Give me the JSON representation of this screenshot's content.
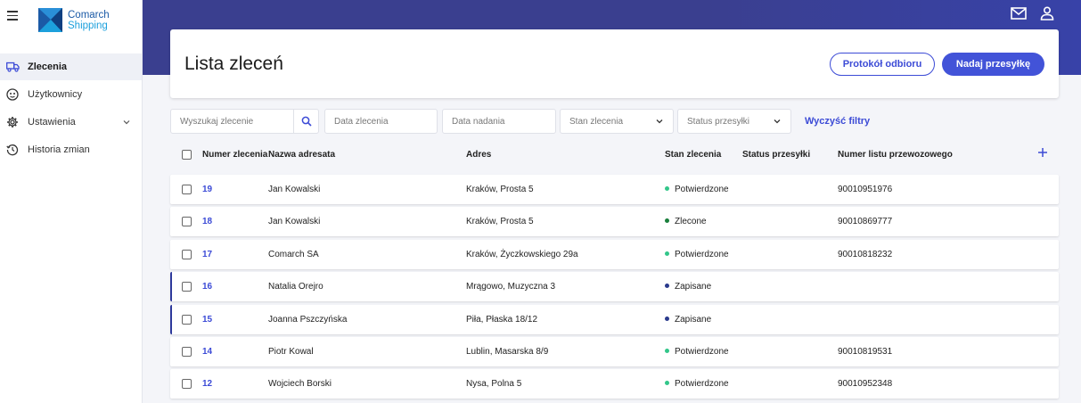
{
  "app": {
    "logo_line1": "Comarch",
    "logo_line2": "Shipping"
  },
  "sidebar": {
    "items": [
      {
        "label": "Zlecenia",
        "icon": "truck-icon",
        "active": true
      },
      {
        "label": "Użytkownicy",
        "icon": "users-icon",
        "active": false
      },
      {
        "label": "Ustawienia",
        "icon": "gear-icon",
        "active": false,
        "expandable": true
      },
      {
        "label": "Historia zmian",
        "icon": "history-icon",
        "active": false
      }
    ]
  },
  "topbar": {
    "icons": [
      "mail-icon",
      "user-icon"
    ]
  },
  "header": {
    "title": "Lista zleceń",
    "secondary_button": "Protokół odbioru",
    "primary_button": "Nadaj przesyłkę"
  },
  "filters": {
    "search_placeholder": "Wyszukaj zlecenie",
    "order_date_placeholder": "Data zlecenia",
    "send_date_placeholder": "Data nadania",
    "order_state_placeholder": "Stan zlecenia",
    "shipment_status_placeholder": "Status przesyłki",
    "clear_label": "Wyczyść filtry"
  },
  "table": {
    "columns": [
      "Numer zlecenia",
      "Nazwa adresata",
      "Adres",
      "Stan zlecenia",
      "Status przesyłki",
      "Numer listu przewozowego"
    ],
    "rows": [
      {
        "number": "19",
        "name": "Jan Kowalski",
        "address": "Kraków, Prosta 5",
        "state": "Potwierdzone",
        "state_color": "#33c68a",
        "shipment_status": "",
        "waybill": "90010951976",
        "marked": false
      },
      {
        "number": "18",
        "name": "Jan Kowalski",
        "address": "Kraków, Prosta 5",
        "state": "Zlecone",
        "state_color": "#1a7f3c",
        "shipment_status": "",
        "waybill": "90010869777",
        "marked": false
      },
      {
        "number": "17",
        "name": "Comarch SA",
        "address": "Kraków, Życzkowskiego 29a",
        "state": "Potwierdzone",
        "state_color": "#33c68a",
        "shipment_status": "",
        "waybill": "90010818232",
        "marked": false
      },
      {
        "number": "16",
        "name": "Natalia Orejro",
        "address": "Mrągowo, Muzyczna 3",
        "state": "Zapisane",
        "state_color": "#2a3a8c",
        "shipment_status": "",
        "waybill": "",
        "marked": true
      },
      {
        "number": "15",
        "name": "Joanna Pszczyńska",
        "address": "Piła, Płaska 18/12",
        "state": "Zapisane",
        "state_color": "#2a3a8c",
        "shipment_status": "",
        "waybill": "",
        "marked": true
      },
      {
        "number": "14",
        "name": "Piotr Kowal",
        "address": "Lublin, Masarska 8/9",
        "state": "Potwierdzone",
        "state_color": "#33c68a",
        "shipment_status": "",
        "waybill": "90010819531",
        "marked": false
      },
      {
        "number": "12",
        "name": "Wojciech Borski",
        "address": "Nysa, Polna 5",
        "state": "Potwierdzone",
        "state_color": "#33c68a",
        "shipment_status": "",
        "waybill": "90010952348",
        "marked": false
      }
    ]
  }
}
